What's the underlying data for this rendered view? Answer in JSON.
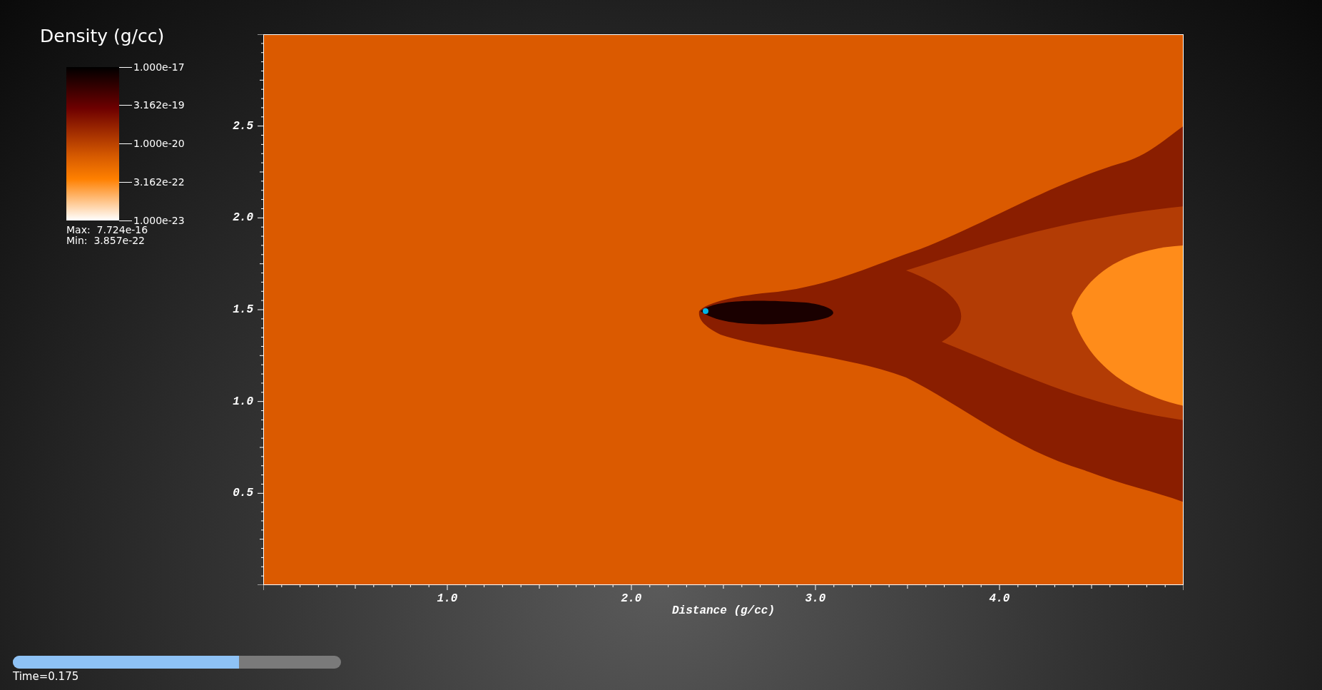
{
  "legend": {
    "title": "Density (g/cc)",
    "ticks": [
      "1.000e-17",
      "3.162e-19",
      "1.000e-20",
      "3.162e-22",
      "1.000e-23"
    ],
    "max": "Max:  7.724e-16",
    "min": "Min:  3.857e-22"
  },
  "plot": {
    "y_ticks": [
      "2.5",
      "2.0",
      "1.5",
      "1.0",
      "0.5"
    ],
    "x_ticks": [
      "1.0",
      "2.0",
      "3.0",
      "4.0"
    ],
    "x_title": "Distance (g/cc)"
  },
  "time_slider": {
    "level": 0.69,
    "label": "Time=0.175"
  }
}
